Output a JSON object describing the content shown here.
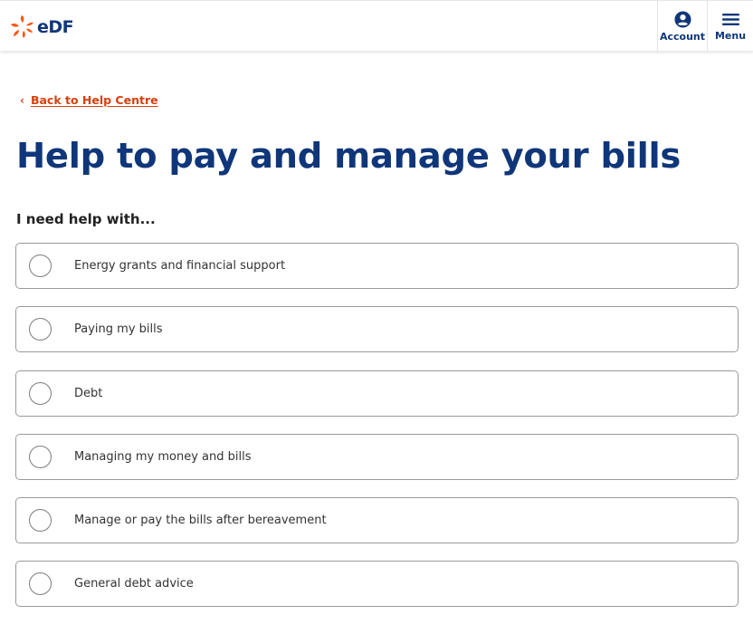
{
  "header": {
    "logo_text": "eDF",
    "account_label": "Account",
    "menu_label": "Menu",
    "brand_colors": {
      "primary": "#10367a",
      "accent": "#fe5716"
    }
  },
  "back_link": {
    "label": "Back to Help Centre",
    "icon": "chevron-left-icon"
  },
  "page": {
    "title": "Help to pay and manage your bills",
    "question": "I need help with..."
  },
  "options": [
    {
      "label": "Energy grants and financial support",
      "selected": false
    },
    {
      "label": "Paying my bills",
      "selected": false
    },
    {
      "label": "Debt",
      "selected": false
    },
    {
      "label": "Managing my money and bills",
      "selected": false
    },
    {
      "label": "Manage or pay the bills after bereavement",
      "selected": false
    },
    {
      "label": "General debt advice",
      "selected": false
    }
  ]
}
